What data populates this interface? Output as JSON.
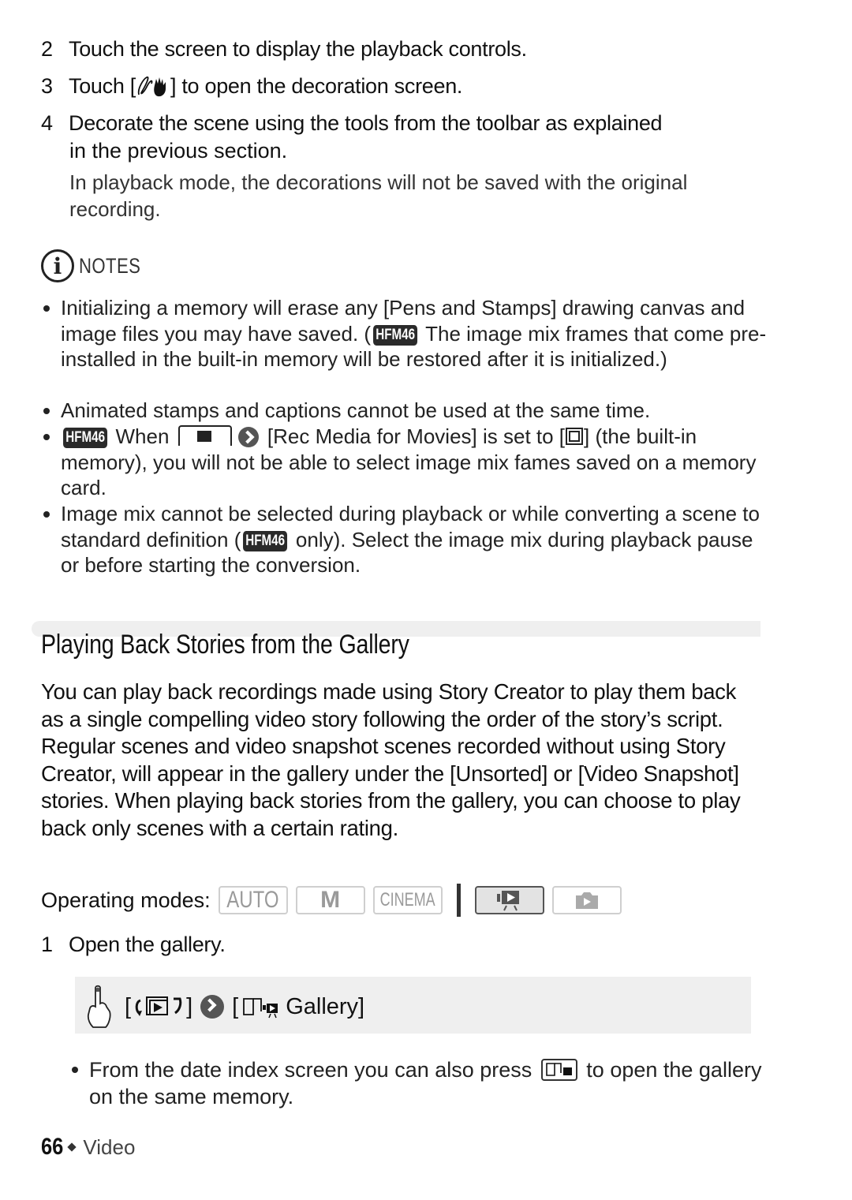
{
  "steps_top": [
    {
      "num": "2",
      "text": "Touch the screen to display the playback controls."
    },
    {
      "num": "3",
      "text_before": "Touch [",
      "icon": "decoration-hand-pen-icon",
      "text_after": "] to open the decoration screen."
    },
    {
      "num": "4",
      "text_line1": "Decorate the scene using the tools from the toolbar as explained",
      "text_line2": "in the previous section."
    }
  ],
  "step4_note": "In playback mode, the decorations will not be saved with the original recording.",
  "notes": {
    "heading": "NOTES",
    "icon": "info-icon",
    "items": [
      {
        "part1": "Initializing a memory will erase any [Pens and Stamps] drawing canvas and image files you may have saved. (",
        "badge": "HFM46",
        "part2": " The image mix frames that come pre-installed in the built-in memory will be restored after it is initialized.)"
      },
      {
        "text": "Animated stamps and captions cannot be used at the same time."
      },
      {
        "badge": "HFM46",
        "part1": " When ",
        "menu_icon": "menu-tab-icon",
        "chevron_icon": "chevron-right-icon",
        "part2": " [Rec Media for Movies] is set to [",
        "memory_icon": "built-in-memory-icon",
        "part3": "] (the built-in memory), you will not be able to select image mix fames saved on a memory card."
      },
      {
        "part1": "Image mix cannot be selected during playback or while converting a scene to standard definition (",
        "badge": "HFM46",
        "part2": " only). Select the image mix during playback pause or before starting the conversion."
      }
    ]
  },
  "section": {
    "title": "Playing Back Stories from the Gallery",
    "intro": "You can play back recordings made using Story Creator to play them back as a single compelling video story following the order of the story’s script. Regular scenes and video snapshot scenes recorded without using Story Creator, will appear in the gallery under the [Unsorted] or [Video Snapshot] stories. When playing back stories from the gallery, you can choose to play back only scenes with a certain rating."
  },
  "operating_modes": {
    "label": "Operating modes:",
    "modes": [
      {
        "label": "AUTO",
        "active": false
      },
      {
        "label": "M",
        "active": false
      },
      {
        "label": "CINEMA",
        "active": false
      },
      {
        "label": "movie-playback-icon",
        "active": true
      },
      {
        "label": "photo-playback-icon",
        "active": false
      }
    ]
  },
  "step1": {
    "num": "1",
    "text": "Open the gallery."
  },
  "procedure": {
    "touch_icon": "touch-finger-icon",
    "item1_icon": "playback-mode-icon",
    "chevron_icon": "chevron-right-icon",
    "item2_icon": "gallery-icon",
    "item2_label": "Gallery"
  },
  "tip": {
    "part1": "From the date index screen you can also press ",
    "button_icon": "gallery-button-icon",
    "part2": " to open the gallery on the same memory."
  },
  "footer": {
    "page_number": "66",
    "section_name": "Video"
  }
}
